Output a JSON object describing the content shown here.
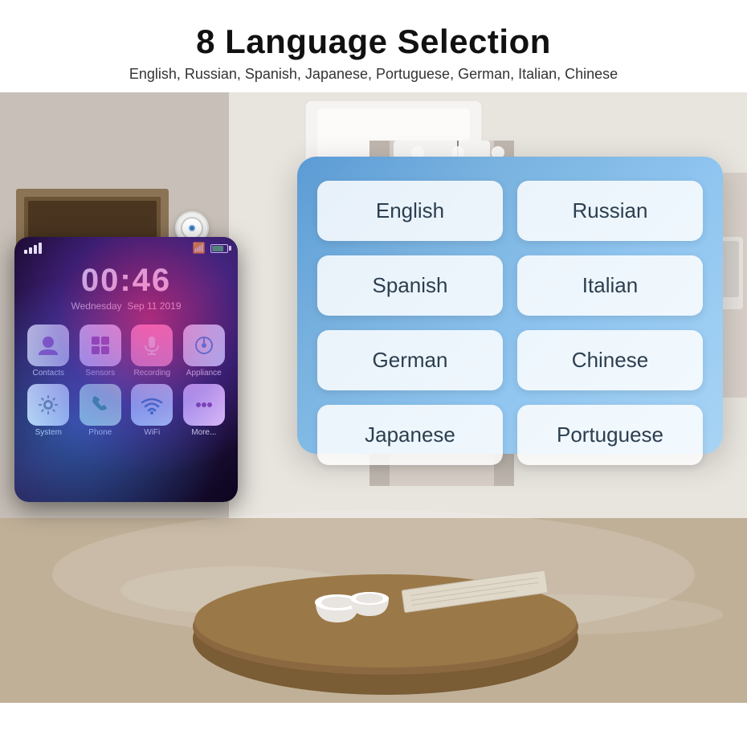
{
  "header": {
    "title": "8 Language Selection",
    "subtitle": "English, Russian, Spanish, Japanese, Portuguese, German, Italian, Chinese"
  },
  "device": {
    "signal": "signal",
    "wifi": "WiFi",
    "battery": "battery",
    "time": "00:46",
    "day": "Wednesday",
    "date": "Sep 11 2019",
    "apps": [
      {
        "label": "Contacts",
        "color": "#e8e8e8",
        "icon": "👤"
      },
      {
        "label": "Sensors",
        "color": "#f0e8ff",
        "icon": "⊞"
      },
      {
        "label": "Recording",
        "color": "#ffe8f0",
        "icon": "🎙"
      },
      {
        "label": "Appliance",
        "color": "#e8f0ff",
        "icon": "🌡"
      },
      {
        "label": "System",
        "color": "#f0f0f0",
        "icon": "⚙"
      },
      {
        "label": "Phone",
        "color": "#e8ffe8",
        "icon": "📞"
      },
      {
        "label": "WiFi",
        "color": "#e8f8ff",
        "icon": "📶"
      },
      {
        "label": "More...",
        "color": "#ffe8ff",
        "icon": "•••"
      }
    ]
  },
  "languages": {
    "buttons": [
      {
        "label": "English",
        "row": 0,
        "col": 0
      },
      {
        "label": "Russian",
        "row": 0,
        "col": 1
      },
      {
        "label": "Spanish",
        "row": 1,
        "col": 0
      },
      {
        "label": "Italian",
        "row": 1,
        "col": 1
      },
      {
        "label": "German",
        "row": 2,
        "col": 0
      },
      {
        "label": "Chinese",
        "row": 2,
        "col": 1
      },
      {
        "label": "Japanese",
        "row": 3,
        "col": 0
      },
      {
        "label": "Portuguese",
        "row": 3,
        "col": 1
      }
    ]
  }
}
